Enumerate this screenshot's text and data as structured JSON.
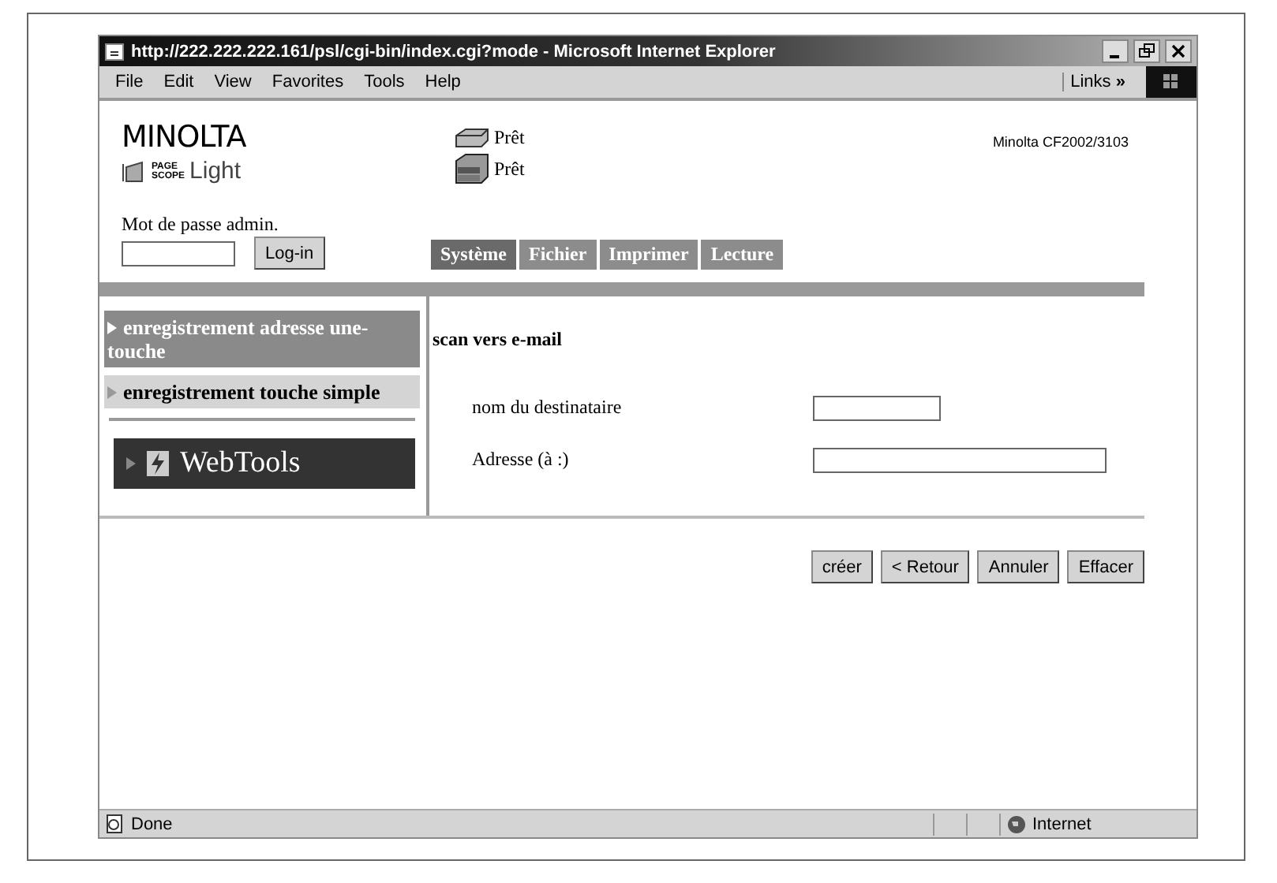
{
  "window": {
    "title": "http://222.222.222.161/psl/cgi-bin/index.cgi?mode - Microsoft Internet Explorer"
  },
  "menu": [
    "File",
    "Edit",
    "View",
    "Favorites",
    "Tools",
    "Help"
  ],
  "links": {
    "label": "Links",
    "chevron": "»"
  },
  "header": {
    "brand": "MINOLTA",
    "product": {
      "line1": "PAGE",
      "line2": "SCOPE",
      "name": "Light"
    },
    "statuses": [
      {
        "kind": "printer",
        "text": "Prêt"
      },
      {
        "kind": "scanner",
        "text": "Prêt"
      }
    ],
    "model": "Minolta CF2002/3103",
    "login": {
      "label": "Mot de passe admin.",
      "button": "Log-in"
    }
  },
  "tabs": [
    {
      "label": "Système",
      "selected": true
    },
    {
      "label": "Fichier",
      "selected": false
    },
    {
      "label": "Imprimer",
      "selected": false
    },
    {
      "label": "Lecture",
      "selected": false
    }
  ],
  "sidebar": {
    "items": [
      {
        "label": "enregistrement adresse une-touche",
        "selected": true
      },
      {
        "label": "enregistrement touche simple",
        "selected": false
      }
    ],
    "webtools": "WebTools"
  },
  "form": {
    "title": "scan vers e-mail",
    "fields": [
      {
        "label": "nom du destinataire"
      },
      {
        "label": "Adresse (à :)"
      }
    ]
  },
  "buttons": [
    "créer",
    "< Retour",
    "Annuler",
    "Effacer"
  ],
  "status_bar": {
    "text": "Done",
    "zone": "Internet"
  }
}
